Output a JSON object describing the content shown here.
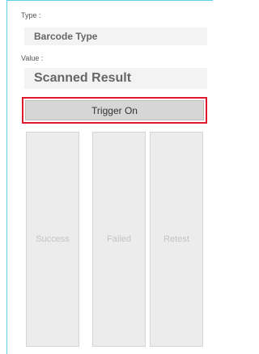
{
  "type": {
    "label": "Type :",
    "value": "Barcode Type"
  },
  "value": {
    "label": "Value :",
    "value": "Scanned Result"
  },
  "trigger": {
    "label": "Trigger On"
  },
  "results": {
    "success": "Success",
    "failed": "Failed",
    "retest": "Retest"
  },
  "colors": {
    "highlight_border": "#e0182b",
    "frame_accent": "#5fd0e6"
  }
}
